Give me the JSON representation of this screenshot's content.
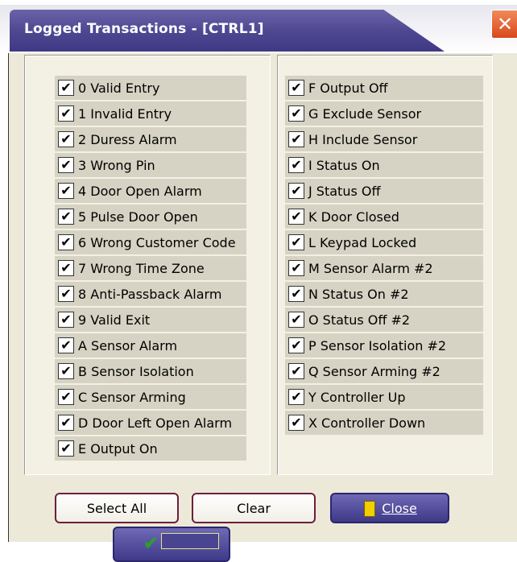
{
  "window": {
    "title": "Logged Transactions - [CTRL1]",
    "close_glyph": "✕",
    "accent_color": "#4d4690"
  },
  "left_list": [
    {
      "label": "0 Valid Entry",
      "checked": true
    },
    {
      "label": "1 Invalid Entry",
      "checked": true
    },
    {
      "label": "2 Duress Alarm",
      "checked": true
    },
    {
      "label": "3 Wrong Pin",
      "checked": true
    },
    {
      "label": "4 Door Open Alarm",
      "checked": true
    },
    {
      "label": "5 Pulse Door Open",
      "checked": true
    },
    {
      "label": "6 Wrong Customer Code",
      "checked": true
    },
    {
      "label": "7 Wrong Time Zone",
      "checked": true
    },
    {
      "label": "8 Anti-Passback Alarm",
      "checked": true
    },
    {
      "label": "9 Valid Exit",
      "checked": true
    },
    {
      "label": "A Sensor Alarm",
      "checked": true
    },
    {
      "label": "B Sensor Isolation",
      "checked": true
    },
    {
      "label": "C Sensor Arming",
      "checked": true
    },
    {
      "label": "D Door Left Open Alarm",
      "checked": true
    },
    {
      "label": "E Output On",
      "checked": true
    }
  ],
  "right_list": [
    {
      "label": "F Output Off",
      "checked": true
    },
    {
      "label": "G Exclude Sensor",
      "checked": true
    },
    {
      "label": "H Include Sensor",
      "checked": true
    },
    {
      "label": "I Status On",
      "checked": true
    },
    {
      "label": "J Status Off",
      "checked": true
    },
    {
      "label": "K Door Closed",
      "checked": true
    },
    {
      "label": "L Keypad Locked",
      "checked": true
    },
    {
      "label": "M Sensor Alarm #2",
      "checked": true
    },
    {
      "label": "N Status On #2",
      "checked": true
    },
    {
      "label": "O Status Off #2",
      "checked": true
    },
    {
      "label": "P Sensor Isolation #2",
      "checked": true
    },
    {
      "label": "Q Sensor Arming #2",
      "checked": true
    },
    {
      "label": "Y Controller Up",
      "checked": true
    },
    {
      "label": "X Controller Down",
      "checked": true
    }
  ],
  "buttons": {
    "select_all": "Select All",
    "clear": "Clear",
    "close": "Close"
  },
  "check_glyph": "✔"
}
